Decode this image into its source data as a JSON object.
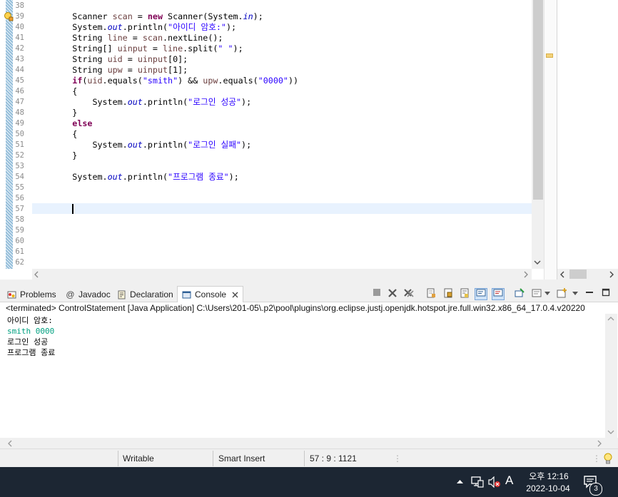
{
  "editor": {
    "line_numbers": [
      "38",
      "39",
      "40",
      "41",
      "42",
      "43",
      "44",
      "45",
      "46",
      "47",
      "48",
      "49",
      "50",
      "51",
      "52",
      "53",
      "54",
      "55",
      "56",
      "57",
      "58",
      "59",
      "60",
      "61",
      "62"
    ],
    "code_lines": [
      [],
      [
        {
          "t": "        Scanner "
        },
        {
          "t": "scan",
          "c": "var"
        },
        {
          "t": " = "
        },
        {
          "t": "new",
          "c": "kw"
        },
        {
          "t": " Scanner(System."
        },
        {
          "t": "in",
          "c": "fld"
        },
        {
          "t": ");"
        }
      ],
      [
        {
          "t": "        System."
        },
        {
          "t": "out",
          "c": "fld"
        },
        {
          "t": ".println("
        },
        {
          "t": "\"아이디 암호:\"",
          "c": "str"
        },
        {
          "t": ");"
        }
      ],
      [
        {
          "t": "        String "
        },
        {
          "t": "line",
          "c": "var"
        },
        {
          "t": " = "
        },
        {
          "t": "scan",
          "c": "var"
        },
        {
          "t": ".nextLine();"
        }
      ],
      [
        {
          "t": "        String[] "
        },
        {
          "t": "uinput",
          "c": "var"
        },
        {
          "t": " = "
        },
        {
          "t": "line",
          "c": "var"
        },
        {
          "t": ".split("
        },
        {
          "t": "\" \"",
          "c": "str"
        },
        {
          "t": ");"
        }
      ],
      [
        {
          "t": "        String "
        },
        {
          "t": "uid",
          "c": "var"
        },
        {
          "t": " = "
        },
        {
          "t": "uinput",
          "c": "var"
        },
        {
          "t": "[0];"
        }
      ],
      [
        {
          "t": "        String "
        },
        {
          "t": "upw",
          "c": "var"
        },
        {
          "t": " = "
        },
        {
          "t": "uinput",
          "c": "var"
        },
        {
          "t": "[1];"
        }
      ],
      [
        {
          "t": "        "
        },
        {
          "t": "if",
          "c": "kw"
        },
        {
          "t": "("
        },
        {
          "t": "uid",
          "c": "var"
        },
        {
          "t": ".equals("
        },
        {
          "t": "\"smith\"",
          "c": "str"
        },
        {
          "t": ") && "
        },
        {
          "t": "upw",
          "c": "var"
        },
        {
          "t": ".equals("
        },
        {
          "t": "\"0000\"",
          "c": "str"
        },
        {
          "t": "))"
        }
      ],
      [
        {
          "t": "        {"
        }
      ],
      [
        {
          "t": "            System."
        },
        {
          "t": "out",
          "c": "fld"
        },
        {
          "t": ".println("
        },
        {
          "t": "\"로그인 성공\"",
          "c": "str"
        },
        {
          "t": ");"
        }
      ],
      [
        {
          "t": "        }"
        }
      ],
      [
        {
          "t": "        "
        },
        {
          "t": "else",
          "c": "kw"
        }
      ],
      [
        {
          "t": "        {"
        }
      ],
      [
        {
          "t": "            System."
        },
        {
          "t": "out",
          "c": "fld"
        },
        {
          "t": ".println("
        },
        {
          "t": "\"로그인 실패\"",
          "c": "str"
        },
        {
          "t": ");"
        }
      ],
      [
        {
          "t": "        }"
        }
      ],
      [],
      [
        {
          "t": "        System."
        },
        {
          "t": "out",
          "c": "fld"
        },
        {
          "t": ".println("
        },
        {
          "t": "\"프로그램 종료\"",
          "c": "str"
        },
        {
          "t": ");"
        }
      ],
      [],
      [],
      [],
      [],
      [],
      [],
      [],
      []
    ]
  },
  "views": {
    "tabs": [
      {
        "label": "Problems",
        "icon": "problems-icon"
      },
      {
        "label": "Javadoc",
        "icon": "javadoc-icon"
      },
      {
        "label": "Declaration",
        "icon": "declaration-icon"
      },
      {
        "label": "Console",
        "icon": "console-icon",
        "active": true
      }
    ]
  },
  "console": {
    "description": "<terminated> ControlStatement [Java Application] C:\\Users\\201-05\\.p2\\pool\\plugins\\org.eclipse.justj.openjdk.hotspot.jre.full.win32.x86_64_17.0.4.v20220",
    "output": [
      {
        "text": "아이디 암호:",
        "color": "#000000"
      },
      {
        "text": "smith 0000",
        "color": "#00a080"
      },
      {
        "text": "로그인 성공",
        "color": "#000000"
      },
      {
        "text": "프로그램 종료",
        "color": "#000000"
      }
    ]
  },
  "status": {
    "writable": "Writable",
    "insert_mode": "Smart Insert",
    "position": "57 : 9 : 1121"
  },
  "taskbar": {
    "ime": "A",
    "time": "오후 12:16",
    "date": "2022-10-04",
    "notification_count": "3"
  },
  "colors": {
    "keyword": "#7f0055",
    "string": "#2a00ff",
    "field": "#0000c0",
    "local_var": "#6a3e3e",
    "console_input": "#00a080",
    "current_line": "#e8f2fe"
  }
}
